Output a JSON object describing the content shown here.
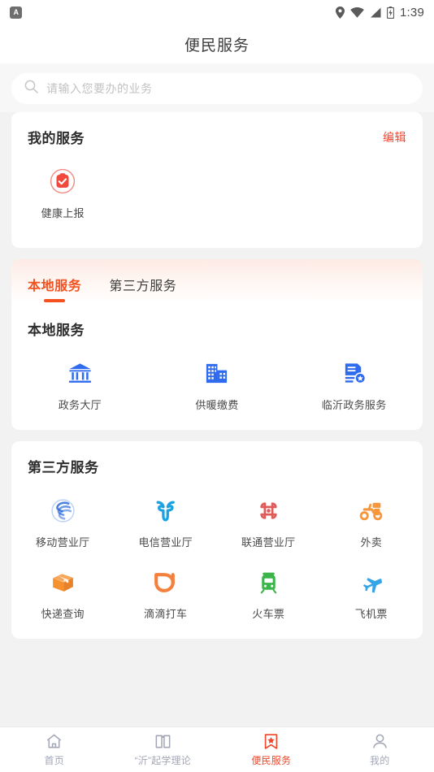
{
  "statusbar": {
    "app_badge": "A",
    "time": "1:39",
    "icons": [
      "location-pin-icon",
      "wifi-icon",
      "signal-bars-icon",
      "battery-charging-icon"
    ]
  },
  "header": {
    "title": "便民服务"
  },
  "search": {
    "placeholder": "请输入您要办的业务",
    "value": "",
    "icon": "search-icon"
  },
  "my_services": {
    "title": "我的服务",
    "edit_label": "编辑",
    "items": [
      {
        "label": "健康上报",
        "icon": "health-report-icon",
        "color": "#ef4a3d"
      }
    ]
  },
  "tabs": [
    {
      "label": "本地服务",
      "active": true
    },
    {
      "label": "第三方服务",
      "active": false
    }
  ],
  "local_services": {
    "title": "本地服务",
    "items": [
      {
        "label": "政务大厅",
        "icon": "government-hall-icon",
        "color": "#2f6bef"
      },
      {
        "label": "供暖缴费",
        "icon": "heating-payment-icon",
        "color": "#2f6bef"
      },
      {
        "label": "临沂政务服务",
        "icon": "linyi-gov-service-icon",
        "color": "#2f6bef"
      }
    ]
  },
  "third_party_services": {
    "title": "第三方服务",
    "items": [
      {
        "label": "移动营业厅",
        "icon": "china-mobile-icon",
        "color": "#2e6bd8"
      },
      {
        "label": "电信营业厅",
        "icon": "china-telecom-icon",
        "color": "#1aa3e0"
      },
      {
        "label": "联通营业厅",
        "icon": "china-unicom-icon",
        "color": "#e05a5a"
      },
      {
        "label": "外卖",
        "icon": "food-delivery-scooter-icon",
        "color": "#f7963a"
      },
      {
        "label": "快递查询",
        "icon": "package-box-icon",
        "color": "#f5922f"
      },
      {
        "label": "滴滴打车",
        "icon": "didi-taxi-icon",
        "color": "#f5803c"
      },
      {
        "label": "火车票",
        "icon": "train-ticket-icon",
        "color": "#3bb54a"
      },
      {
        "label": "飞机票",
        "icon": "plane-ticket-icon",
        "color": "#35a5e8"
      }
    ]
  },
  "bottom_nav": [
    {
      "label": "首页",
      "icon": "home-icon",
      "active": false
    },
    {
      "label": "“沂”起学理论",
      "icon": "book-icon",
      "active": false
    },
    {
      "label": "便民服务",
      "icon": "bookmark-star-icon",
      "active": true
    },
    {
      "label": "我的",
      "icon": "person-icon",
      "active": false
    }
  ],
  "colors": {
    "accent_red": "#ef4528",
    "tab_active": "#f4511e",
    "edit_red": "#f4432e",
    "blue": "#2f6bef",
    "page_bg": "#f2f2f2",
    "card_bg": "#ffffff",
    "nav_inactive": "#a3a6b5"
  }
}
